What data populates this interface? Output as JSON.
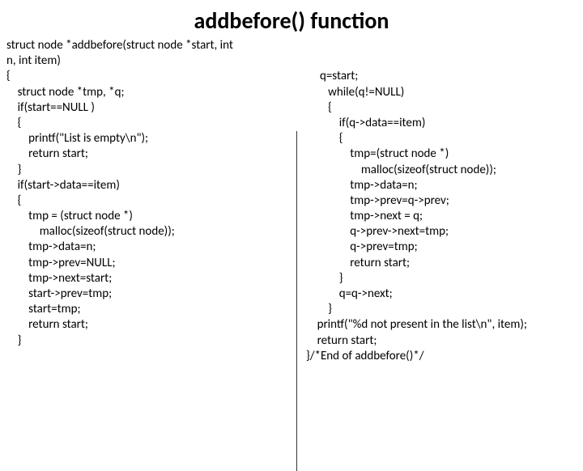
{
  "title": "addbefore() function",
  "left_code": "struct node *addbefore(struct node *start, int\nn, int item)\n{\n    struct node *tmp, *q;\n    if(start==NULL )\n    {\n        printf(\"List is empty\\n\");\n        return start;\n    }\n    if(start->data==item)\n    {\n        tmp = (struct node *)\n            malloc(sizeof(struct node));\n        tmp->data=n;\n        tmp->prev=NULL;\n        tmp->next=start;\n        start->prev=tmp;\n        start=tmp;\n        return start;\n    }",
  "right_code": "\n\n     q=start;\n        while(q!=NULL)\n        {\n            if(q->data==item)\n            {\n                tmp=(struct node *)\n                    malloc(sizeof(struct node));\n                tmp->data=n;\n                tmp->prev=q->prev;\n                tmp->next = q;\n                q->prev->next=tmp;\n                q->prev=tmp;\n                return start;\n            }\n            q=q->next;\n        }\n    printf(\"%d not present in the list\\n\", item);\n    return start;\n}/*End of addbefore()*/"
}
